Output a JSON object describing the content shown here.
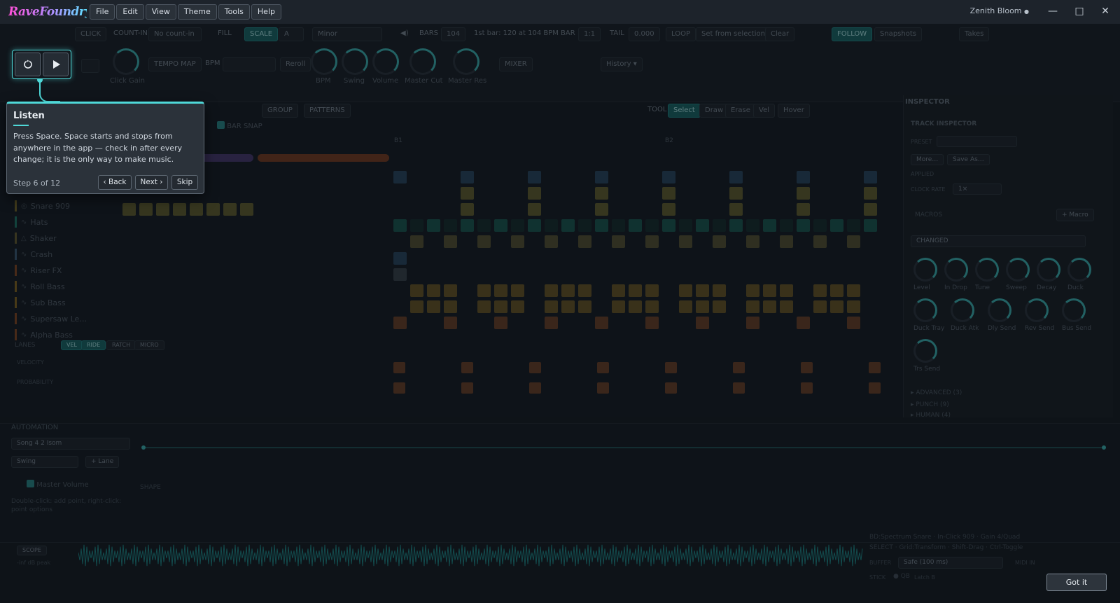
{
  "app": {
    "logo": "RaveFoundry",
    "user": "Zenith Bloom",
    "user_dot": "●"
  },
  "menus": [
    "File",
    "Edit",
    "View",
    "Theme",
    "Tools",
    "Help"
  ],
  "window_controls": {
    "minimize": "—",
    "maximize": "□",
    "close": "✕"
  },
  "toolbar": {
    "row1": [
      "CLICK",
      "COUNT-IN",
      "No count-in",
      "FILL",
      "SCALE",
      "A",
      "Minor",
      "BARS",
      "104",
      "1st bar: 120 at 104 BPM",
      "BAR",
      "1:1",
      "TAIL",
      "0.000",
      "LOOP",
      "Set from selection",
      "Clear",
      "FOLLOW",
      "Snapshots",
      "Takes"
    ],
    "row2": [
      "TEMPO MAP",
      "BPM",
      "Reroll",
      "MIXER",
      "History ▾"
    ],
    "knobs": [
      "Click Gain",
      "BPM",
      "Swing",
      "Volume",
      "Master Cut",
      "Master Res"
    ]
  },
  "editor": {
    "row3": [
      "GROUP",
      "PATTERNS",
      "TOOL",
      "Select",
      "Draw",
      "Erase",
      "Vel",
      "Hover"
    ],
    "bar_snap": "BAR SNAP",
    "bar_markers": [
      "B1",
      "B2"
    ],
    "tracks": [
      "Snare 909",
      "Hats",
      "Shaker",
      "Crash",
      "Riser FX",
      "Roll Bass",
      "Sub Bass",
      "Supersaw Le…",
      "Alpha Bass"
    ],
    "lanes": {
      "title": "LANES",
      "tabs": [
        "VEL",
        "RIDE",
        "RATCH",
        "MICRO"
      ],
      "rows": [
        "VELOCITY",
        "PROBABILITY"
      ]
    }
  },
  "inspector": {
    "title": "INSPECTOR",
    "track_title": "TRACK INSPECTOR",
    "preset": "PRESET",
    "more": "More…",
    "save_as": "Save As…",
    "applied": "APPLIED",
    "clock_rate": "CLOCK RATE",
    "clock_value": "1×",
    "macros": "MACROS",
    "macro_btn": "+ Macro",
    "changed": "CHANGED",
    "knobs_row1": [
      "Level",
      "In Drop",
      "Tune",
      "Sweep",
      "Decay",
      "Duck"
    ],
    "knobs_row2": [
      "Duck Tray",
      "Duck Atk",
      "Dly Send",
      "Rev Send",
      "Bus Send"
    ],
    "knobs_row3": [
      "Trs Send"
    ],
    "sections": [
      "ADVANCED (3)",
      "PUNCH (9)",
      "HUMAN (4)"
    ]
  },
  "automation": {
    "title": "AUTOMATION",
    "mode": "Song",
    "target": "4 2 Isom",
    "param": "Swing",
    "add_lane": "+ Lane",
    "check_label": "Master Volume",
    "shape": "SHAPE",
    "hint": "Double-click: add point, right-click: point options"
  },
  "bottom": {
    "tag": "SCOPE",
    "level": "-inf dB peak",
    "info1": "BD:Spectrum Snare · In-Click 909 · Gain 4/Quad",
    "info2": "SELECT · Grid:Transform · Shift-Drag · Ctrl-Toggle",
    "buffer_label": "BUFFER",
    "buffer_value": "Safe (100 ms)",
    "midi_in": "MIDI IN",
    "stick": "STICK",
    "qb": "QB",
    "latch": "Latch B"
  },
  "popover": {
    "title": "Listen",
    "body": "Press Space. Space starts and stops from anywhere in the app — check in after every change; it is the only way to make music.",
    "step": "Step 6 of 12",
    "back": "‹ Back",
    "next": "Next ›",
    "skip": "Skip"
  },
  "got_it": "Got it",
  "colors": {
    "accent": "#4fd8d8",
    "kick": "#3c6e96",
    "snare": "#a99a3a",
    "hats": "#1e8c78",
    "shaker": "#8f8242",
    "bass": "#b38a28",
    "riser": "#b8602c",
    "clip_purple": "#6b4f9a",
    "clip_orange": "#b5582e"
  }
}
